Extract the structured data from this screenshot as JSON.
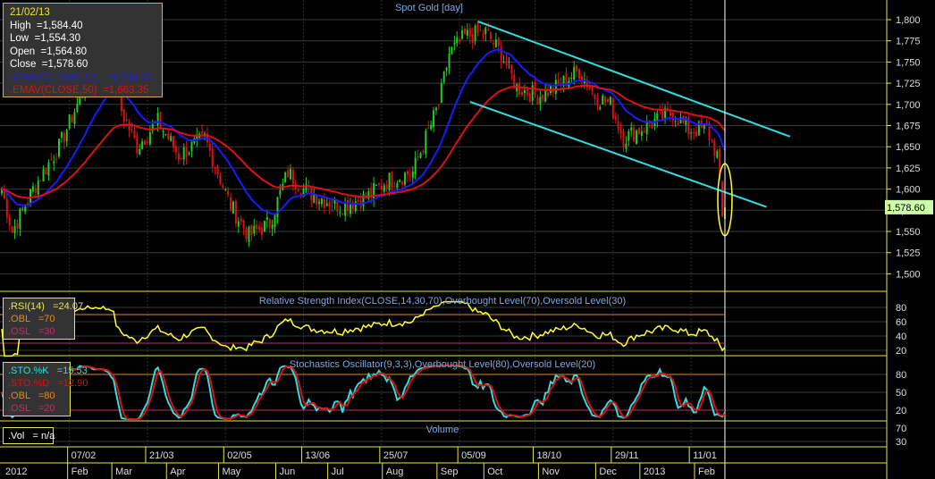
{
  "info_box": {
    "date": "21/02/13",
    "high": "High  =1,584.40",
    "low": "Low  =1,554.30",
    "open": "Open  =1,564.80",
    "close": "Close  =1,578.60",
    "ema20": ".EMAV(CLOSE,20)   =1,639.37",
    "ema50": ".EMAV(CLOSE,50)  =1,663.35"
  },
  "rsi_box": {
    "rsi": ".RSI(14)   =24.07",
    "obl": ".OBL   =70",
    "osl": ".OSL   =30"
  },
  "sto_box": {
    "k": ".STO.%K   =15.53",
    "d": ".STO.%D   =12.90",
    "obl": ".OBL   =80",
    "osl": ".OSL   =20"
  },
  "vol_box": {
    "vol": ".Vol   = n/a"
  },
  "colors": {
    "up": "#22cc22",
    "down": "#dd1111",
    "ema20": "#1a1aff",
    "ema50": "#dd1111",
    "trend": "#33dddd",
    "rsi": "#ffff33",
    "stoK": "#33dddd",
    "stoD": "#dd1111",
    "panel": "#e6e64a",
    "last_price_bg": "#ccffaa"
  },
  "chart_data": [
    {
      "type": "candlestick",
      "title": "Spot Gold [day]",
      "ylim": [
        1490,
        1825
      ],
      "yticks": [
        "1,500",
        "1,525",
        "1,550",
        "1,575",
        "1,600",
        "1,625",
        "1,650",
        "1,675",
        "1,700",
        "1,725",
        "1,750",
        "1,775",
        "1,800"
      ],
      "ytick_values": [
        1500,
        1525,
        1550,
        1575,
        1600,
        1625,
        1650,
        1675,
        1700,
        1725,
        1750,
        1775,
        1800
      ],
      "last_price_label": "1,578.60",
      "last_close": 1578.6,
      "close_path_bar_price": [
        [
          0,
          1600
        ],
        [
          4,
          1550
        ],
        [
          12,
          1600
        ],
        [
          22,
          1650
        ],
        [
          34,
          1735
        ],
        [
          42,
          1760
        ],
        [
          45,
          1700
        ],
        [
          52,
          1650
        ],
        [
          60,
          1680
        ],
        [
          68,
          1640
        ],
        [
          78,
          1660
        ],
        [
          88,
          1580
        ],
        [
          95,
          1545
        ],
        [
          103,
          1560
        ],
        [
          110,
          1620
        ],
        [
          116,
          1600
        ],
        [
          122,
          1590
        ],
        [
          130,
          1580
        ],
        [
          140,
          1590
        ],
        [
          148,
          1610
        ],
        [
          158,
          1620
        ],
        [
          163,
          1660
        ],
        [
          168,
          1700
        ],
        [
          172,
          1760
        ],
        [
          178,
          1780
        ],
        [
          186,
          1785
        ],
        [
          192,
          1760
        ],
        [
          198,
          1720
        ],
        [
          206,
          1710
        ],
        [
          213,
          1720
        ],
        [
          222,
          1740
        ],
        [
          228,
          1710
        ],
        [
          234,
          1700
        ],
        [
          239,
          1660
        ],
        [
          245,
          1670
        ],
        [
          251,
          1680
        ],
        [
          258,
          1690
        ],
        [
          264,
          1670
        ],
        [
          271,
          1670
        ],
        [
          275,
          1640
        ],
        [
          277,
          1565
        ],
        [
          278,
          1578.6
        ]
      ],
      "series": [
        "EMAV(CLOSE,20)",
        "EMAV(CLOSE,50)"
      ],
      "trendlines_bar_price": [
        [
          [
            183,
            1798
          ],
          [
            303,
            1662
          ]
        ],
        [
          [
            180,
            1703
          ],
          [
            294,
            1579
          ]
        ]
      ],
      "highlight_ellipse": {
        "bar": 278,
        "price_low": 1545,
        "price_high": 1630
      }
    },
    {
      "type": "line",
      "title": "Relative Strength Index(CLOSE,14,30,70),Overbought Level(70),Oversold Level(30)",
      "yticks": [
        "80",
        "60",
        "40",
        "20"
      ],
      "ytick_values": [
        80,
        60,
        40,
        20
      ],
      "ylim": [
        10,
        90
      ],
      "levels": [
        70,
        30
      ],
      "last": 24.07
    },
    {
      "type": "line",
      "title": "Stochastics Oscillator(9,3,3),Overbought Level(80),Oversold Level(20)",
      "yticks": [
        "80",
        "50",
        "20"
      ],
      "ytick_values": [
        80,
        50,
        20
      ],
      "ylim": [
        0,
        100
      ],
      "levels": [
        80,
        20
      ],
      "last_k": 15.53,
      "last_d": 12.9
    },
    {
      "type": "bar",
      "title": "Volume",
      "yticks": [
        "70",
        "30"
      ],
      "ytick_values": [
        70,
        30
      ],
      "ylim": [
        0,
        100
      ]
    }
  ],
  "date_axis": {
    "row1": [
      {
        "label": "07/02",
        "bar": 26
      },
      {
        "label": "21/03",
        "bar": 56
      },
      {
        "label": "02/05",
        "bar": 86
      },
      {
        "label": "13/06",
        "bar": 116
      },
      {
        "label": "25/07",
        "bar": 146
      },
      {
        "label": "05/09",
        "bar": 176
      },
      {
        "label": "18/10",
        "bar": 205
      },
      {
        "label": "29/11",
        "bar": 235
      },
      {
        "label": "11/01",
        "bar": 265
      }
    ],
    "row2": [
      {
        "label": "2012",
        "bar": 0
      },
      {
        "label": "Feb",
        "bar": 26
      },
      {
        "label": "Mar",
        "bar": 43
      },
      {
        "label": "Apr",
        "bar": 64
      },
      {
        "label": "May",
        "bar": 84
      },
      {
        "label": "Jun",
        "bar": 106
      },
      {
        "label": "Jul",
        "bar": 126
      },
      {
        "label": "Aug",
        "bar": 147
      },
      {
        "label": "Sep",
        "bar": 168
      },
      {
        "label": "Oct",
        "bar": 186
      },
      {
        "label": "Nov",
        "bar": 207
      },
      {
        "label": "Dec",
        "bar": 229
      },
      {
        "label": "2013",
        "bar": 246
      },
      {
        "label": "Feb",
        "bar": 267
      }
    ]
  }
}
